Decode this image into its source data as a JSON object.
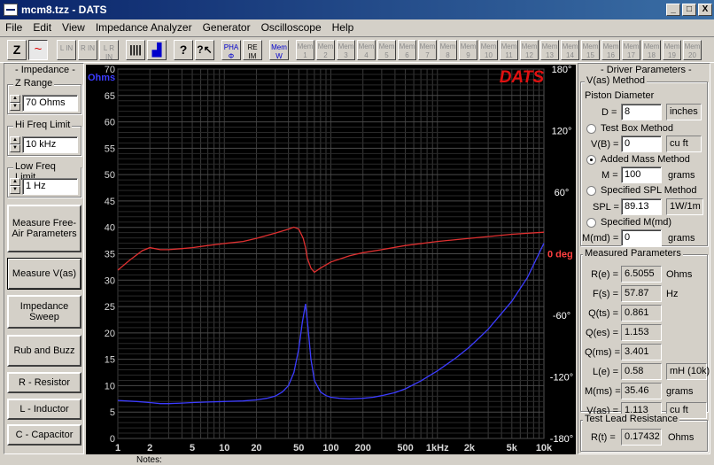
{
  "window": {
    "title": "mcm8.tzz - DATS",
    "controls": [
      "_",
      "□",
      "X"
    ]
  },
  "menu": [
    "File",
    "Edit",
    "View",
    "Impedance Analyzer",
    "Generator",
    "Oscilloscope",
    "Help"
  ],
  "toolbar": {
    "buttons": [
      {
        "label": "Z"
      },
      {
        "label": "~"
      },
      {
        "label": "L IN"
      },
      {
        "label": "R IN"
      },
      {
        "label": "L R IN"
      },
      {
        "label": "||||"
      },
      {
        "label": "▟"
      },
      {
        "label": "?"
      },
      {
        "label": "?↖"
      },
      {
        "label": "PHA Φ"
      },
      {
        "label": "RE IM"
      },
      {
        "label": "Mem W"
      }
    ],
    "mem_slots": [
      "1",
      "2",
      "3",
      "4",
      "5",
      "6",
      "7",
      "8",
      "9",
      "10",
      "11",
      "12",
      "13",
      "14",
      "15",
      "16",
      "17",
      "18",
      "19",
      "20"
    ],
    "mem_label": "Mem"
  },
  "left": {
    "impedance_label": "- Impedance -",
    "z_range_label": "Z Range",
    "z_range_value": "70 Ohms",
    "hi_freq_label": "Hi Freq Limit",
    "hi_freq_value": "10 kHz",
    "low_freq_label": "Low Freq Limit",
    "low_freq_value": "1 Hz",
    "buttons": {
      "free_air": "Measure Free-Air Parameters",
      "measure_vas": "Measure V(as)",
      "impedance_sweep": "Impedance Sweep",
      "rub_buzz": "Rub and Buzz",
      "r_resistor": "R - Resistor",
      "l_inductor": "L - Inductor",
      "c_capacitor": "C - Capacitor"
    }
  },
  "right": {
    "driver_params_label": "- Driver Parameters -",
    "vas_method_label": "V(as) Method",
    "piston_label": "Piston Diameter",
    "d_label": "D =",
    "d_value": "8",
    "d_unit": "inches",
    "test_box_label": "Test Box Method",
    "vb_label": "V(B) =",
    "vb_value": "0",
    "vb_unit": "cu ft",
    "added_mass_label": "Added Mass Method",
    "m_label": "M =",
    "m_value": "100",
    "m_unit": "grams",
    "spl_method_label": "Specified SPL Method",
    "spl_label": "SPL =",
    "spl_value": "89.13",
    "spl_unit": "1W/1m",
    "specified_mmd_label": "Specified M(md)",
    "mmd_label": "M(md) =",
    "mmd_value": "0",
    "mmd_unit": "grams",
    "measured_label": "Measured Parameters",
    "measured": [
      {
        "name": "R(e) =",
        "value": "6.5055",
        "unit": "Ohms"
      },
      {
        "name": "F(s) =",
        "value": "57.87",
        "unit": "Hz"
      },
      {
        "name": "Q(ts) =",
        "value": "0.861",
        "unit": ""
      },
      {
        "name": "Q(es) =",
        "value": "1.153",
        "unit": ""
      },
      {
        "name": "Q(ms) =",
        "value": "3.401",
        "unit": ""
      },
      {
        "name": "L(e) =",
        "value": "0.58",
        "unit": "mH (10k)"
      },
      {
        "name": "M(ms) =",
        "value": "35.46",
        "unit": "grams"
      },
      {
        "name": "V(as) =",
        "value": "1.113",
        "unit": "cu ft"
      }
    ],
    "test_lead_label": "Test Lead Resistance",
    "rt_label": "R(t) =",
    "rt_value": "0.17432",
    "rt_unit": "Ohms"
  },
  "notes_label": "Notes:",
  "chart_data": {
    "type": "line",
    "brand": "DATS",
    "left_unit": "Ohms",
    "right_unit": "deg",
    "x_scale": "log",
    "xlim": [
      1,
      10000
    ],
    "ylim": [
      0,
      70
    ],
    "phase_lim": [
      -180,
      180
    ],
    "x_ticks": [
      1,
      2,
      5,
      10,
      20,
      50,
      100,
      200,
      500,
      1000,
      2000,
      5000,
      10000
    ],
    "x_tick_labels": [
      "1",
      "2",
      "5",
      "10",
      "20",
      "50",
      "100",
      "200",
      "500",
      "1kHz",
      "2k",
      "5k",
      "10k"
    ],
    "y_ticks": [
      0,
      5,
      10,
      15,
      20,
      25,
      30,
      35,
      40,
      45,
      50,
      55,
      60,
      65,
      70
    ],
    "phase_ticks": [
      180,
      120,
      60,
      0,
      -60,
      -120,
      -180
    ],
    "phase_tick_labels": [
      "180°",
      "120°",
      "60°",
      "0 deg",
      "-60°",
      "-120°",
      "-180°"
    ],
    "grid": true,
    "colors": {
      "background": "#000000",
      "grid": "#3a3a3a",
      "impedance": "#3c3cff",
      "phase": "#e03030",
      "left_text": "#d8d8d8",
      "right_text": "#ffffff",
      "brand": "#e01010"
    },
    "series": [
      {
        "x": [
          1,
          1.5,
          2,
          2.5,
          3,
          4,
          5,
          7,
          10,
          15,
          20,
          25,
          30,
          35,
          40,
          45,
          50,
          54,
          57.87,
          61,
          65,
          70,
          80,
          90,
          100,
          120,
          150,
          200,
          250,
          300,
          400,
          500,
          700,
          1000,
          1500,
          2000,
          3000,
          5000,
          7000,
          10000
        ],
        "values": [
          7.2,
          7.0,
          6.8,
          6.6,
          6.6,
          6.7,
          6.8,
          6.9,
          7.0,
          7.1,
          7.3,
          7.6,
          8.0,
          8.8,
          10.0,
          12.5,
          17.0,
          22.0,
          25.5,
          21.0,
          15.0,
          11.0,
          8.8,
          8.1,
          7.8,
          7.6,
          7.5,
          7.6,
          7.8,
          8.1,
          8.7,
          9.4,
          10.9,
          12.8,
          15.3,
          17.3,
          20.7,
          26.0,
          30.5,
          37.0
        ]
      },
      {
        "x": [
          1,
          1.3,
          1.7,
          2,
          2.5,
          3,
          4,
          5,
          7,
          10,
          15,
          20,
          30,
          40,
          45,
          50,
          55,
          57.87,
          60,
          65,
          70,
          80,
          100,
          150,
          200,
          300,
          500,
          1000,
          2000,
          5000,
          10000
        ],
        "values": [
          -16,
          -6,
          3,
          6,
          4,
          4,
          5,
          6,
          8,
          10,
          12,
          15,
          20,
          24,
          26,
          24,
          15,
          6,
          -4,
          -14,
          -18,
          -14,
          -8,
          -2,
          1,
          4,
          8,
          12,
          15,
          19,
          21
        ]
      }
    ]
  }
}
